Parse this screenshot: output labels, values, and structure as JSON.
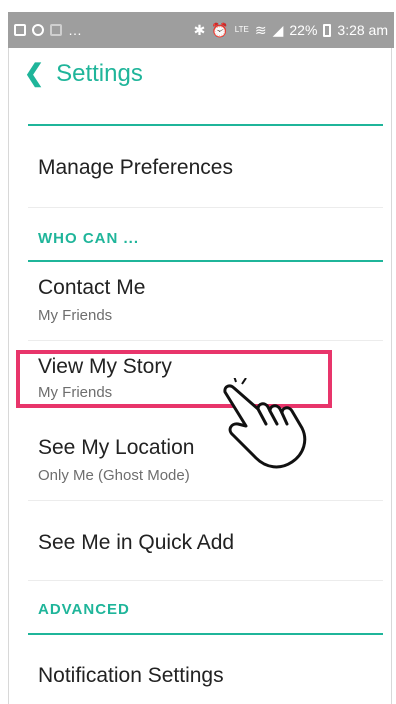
{
  "status_bar": {
    "battery": "22%",
    "time": "3:28 am",
    "signal_label": "LTE"
  },
  "header": {
    "title": "Settings"
  },
  "rows": {
    "manage_preferences": {
      "title": "Manage Preferences"
    },
    "contact_me": {
      "title": "Contact Me",
      "subtitle": "My Friends"
    },
    "view_my_story": {
      "title": "View My Story",
      "subtitle": "My Friends"
    },
    "see_my_location": {
      "title": "See My Location",
      "subtitle": "Only Me (Ghost Mode)"
    },
    "see_me_in_quick_add": {
      "title": "See Me in Quick Add"
    },
    "notification_settings": {
      "title": "Notification Settings"
    }
  },
  "sections": {
    "who_can": "WHO CAN ...",
    "advanced": "ADVANCED"
  },
  "colors": {
    "accent": "#1fb59a",
    "highlight": "#e8356b",
    "status_bar": "#9e9e9e"
  }
}
